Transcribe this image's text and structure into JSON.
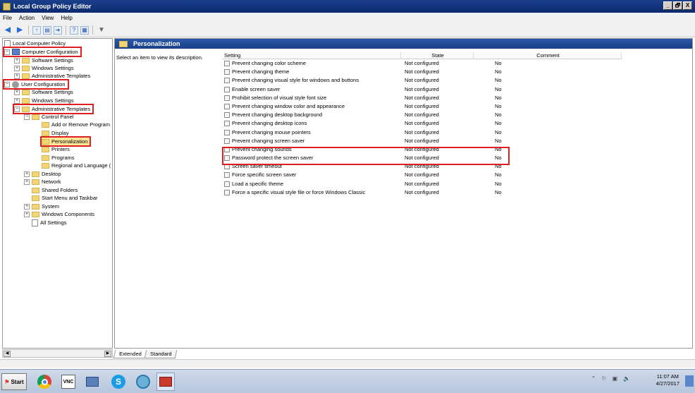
{
  "window": {
    "title": "Local Group Policy Editor",
    "buttons": [
      "_",
      "🗗",
      "X"
    ]
  },
  "menu": [
    "File",
    "Action",
    "View",
    "Help"
  ],
  "tree": {
    "root": "Local Computer Policy",
    "computer_config": "Computer Configuration",
    "cc_software": "Software Settings",
    "cc_windows": "Windows Settings",
    "cc_admin": "Administrative Templates",
    "user_config": "User Configuration",
    "uc_software": "Software Settings",
    "uc_windows": "Windows Settings",
    "uc_admin": "Administrative Templates",
    "control_panel": "Control Panel",
    "add_remove": "Add or Remove Program",
    "display": "Display",
    "personalization": "Personalization",
    "printers": "Printers",
    "programs": "Programs",
    "regional": "Regional and Language (",
    "desktop": "Desktop",
    "network": "Network",
    "shared_folders": "Shared Folders",
    "start_menu": "Start Menu and Taskbar",
    "system": "System",
    "windows_components": "Windows Components",
    "all_settings": "All Settings"
  },
  "right_header": "Personalization",
  "description_text": "Select an item to view its description.",
  "columns": {
    "setting": "Setting",
    "state": "State",
    "comment": "Comment"
  },
  "policies": [
    {
      "setting": "Prevent changing color scheme",
      "state": "Not configured",
      "comment": "No"
    },
    {
      "setting": "Prevent changing theme",
      "state": "Not configured",
      "comment": "No"
    },
    {
      "setting": "Prevent changing visual style for windows and buttons",
      "state": "Not configured",
      "comment": "No"
    },
    {
      "setting": "Enable screen saver",
      "state": "Not configured",
      "comment": "No"
    },
    {
      "setting": "Prohibit selection of visual style font size",
      "state": "Not configured",
      "comment": "No"
    },
    {
      "setting": "Prevent changing window color and appearance",
      "state": "Not configured",
      "comment": "No"
    },
    {
      "setting": "Prevent changing desktop background",
      "state": "Not configured",
      "comment": "No"
    },
    {
      "setting": "Prevent changing desktop icons",
      "state": "Not configured",
      "comment": "No"
    },
    {
      "setting": "Prevent changing mouse pointers",
      "state": "Not configured",
      "comment": "No"
    },
    {
      "setting": "Prevent changing screen saver",
      "state": "Not configured",
      "comment": "No"
    },
    {
      "setting": "Prevent changing sounds",
      "state": "Not configured",
      "comment": "No"
    },
    {
      "setting": "Password protect the screen saver",
      "state": "Not configured",
      "comment": "No"
    },
    {
      "setting": "Screen saver timeout",
      "state": "Not configured",
      "comment": "No"
    },
    {
      "setting": "Force specific screen saver",
      "state": "Not configured",
      "comment": "No"
    },
    {
      "setting": "Load a specific theme",
      "state": "Not configured",
      "comment": "No"
    },
    {
      "setting": "Force a specific visual style file or force Windows Classic",
      "state": "Not configured",
      "comment": "No"
    }
  ],
  "tabs": [
    "Extended",
    "Standard"
  ],
  "taskbar": {
    "start": "Start",
    "time": "11:07 AM",
    "date": "4/27/2017",
    "vnc_label": "VNC"
  },
  "colors": {
    "highlight": "#e02020",
    "title_bar": "#0b2a6e",
    "header_band": "#1a3f86",
    "folder": "#f2d676"
  }
}
